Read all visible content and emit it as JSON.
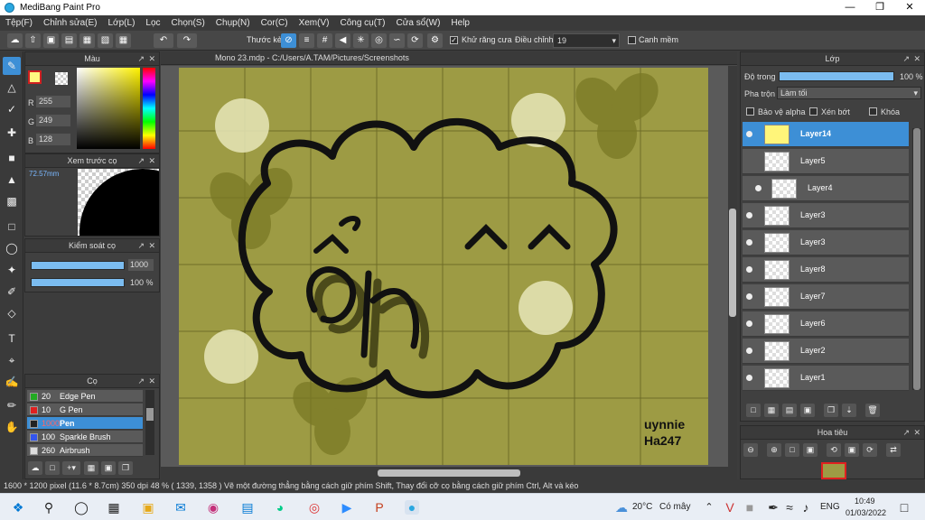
{
  "window": {
    "title": "MediBang Paint Pro"
  },
  "menu": [
    "Tệp(F)",
    "Chỉnh sửa(E)",
    "Lớp(L)",
    "Lọc",
    "Chọn(S)",
    "Chụp(N)",
    "Cor(C)",
    "Xem(V)",
    "Công cụ(T)",
    "Cửa sổ(W)",
    "Help"
  ],
  "toolbar": {
    "stroke_label": "Thước kẻ",
    "antialias_label": "Khử răng cưa",
    "adjust_label": "Điều chỉnh",
    "adjust_value": "19",
    "smooth_label": "Canh mềm"
  },
  "panels": {
    "color_title": "Màu",
    "rgb": {
      "r_label": "R",
      "g_label": "G",
      "b_label": "B",
      "r": "255",
      "g": "249",
      "b": "128"
    },
    "preview_title": "Xem trước cọ",
    "preview_size": "72.57mm",
    "brush_control_title": "Kiểm soát cọ",
    "brush_size": "1000",
    "brush_opacity": "100 %",
    "brush_list_title": "Cọ",
    "brushes": [
      {
        "size": "20",
        "name": "Edge Pen",
        "color": "#22aa22"
      },
      {
        "size": "10",
        "name": "G Pen",
        "color": "#e02020"
      },
      {
        "size": "1000",
        "name": "Pen",
        "color": "#222222"
      },
      {
        "size": "100",
        "name": "Sparkle Brush",
        "color": "#3355ee"
      },
      {
        "size": "260",
        "name": "Airbrush",
        "color": "#dddddd"
      }
    ]
  },
  "document": {
    "tab_label": "Mono 23.mdp - C:/Users/A.TAM/Pictures/Screenshots"
  },
  "layers_panel": {
    "title": "Lớp",
    "opacity_label": "Độ trong",
    "opacity_value": "100 %",
    "blend_label": "Pha trộn",
    "blend_value": "Làm tối",
    "protect_alpha": "Bảo vệ alpha",
    "clipping": "Xén bớt",
    "lock": "Khóa",
    "layers": [
      "Layer14",
      "Layer5",
      "Layer4",
      "Layer3",
      "Layer3",
      "Layer8",
      "Layer7",
      "Layer6",
      "Layer2",
      "Layer1"
    ]
  },
  "navigator": {
    "title": "Hoa tiêu"
  },
  "canvas": {
    "signature_line1": "uynnie",
    "signature_line2": "Ha247",
    "bg_color": "#9d9b44",
    "stroke_color": "#111111"
  },
  "statusbar": {
    "text": "1600 * 1200 pixel  (11.6 * 8.7cm)  350 dpi  48 %  ( 1339, 1358 )  Vẽ một đường thẳng bằng cách giữ phím Shift, Thay đổi cỡ cọ bằng cách giữ phím Ctrl, Alt và kéo"
  },
  "taskbar": {
    "weather_temp": "20°C",
    "weather_text": "Có mây",
    "language": "ENG",
    "time": "10:49",
    "date": "01/03/2022"
  }
}
